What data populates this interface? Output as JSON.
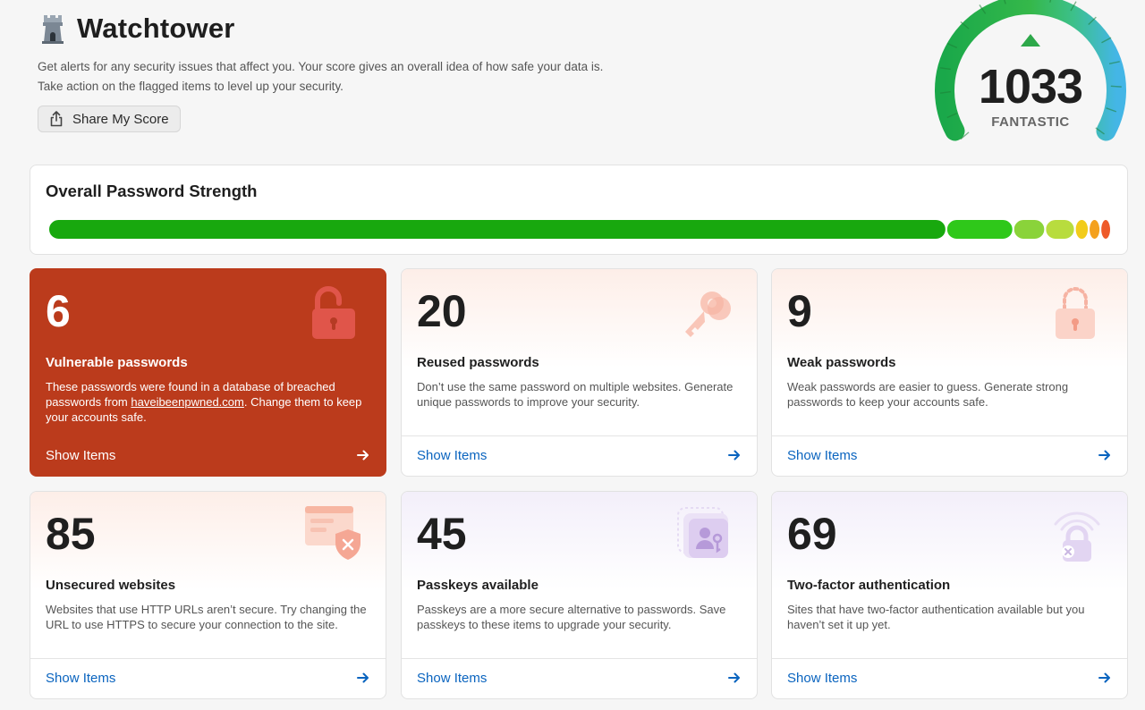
{
  "header": {
    "title": "Watchtower",
    "description": "Get alerts for any security issues that affect you. Your score gives an overall idea of how safe your data is. Take action on the flagged items to level up your security.",
    "share_label": "Share My Score"
  },
  "gauge": {
    "score": "1033",
    "rating": "FANTASTIC"
  },
  "strength": {
    "title": "Overall Password Strength",
    "segments": [
      {
        "fraction": 0.845,
        "color": "#18a80e"
      },
      {
        "fraction": 0.063,
        "color": "#2fc81a"
      },
      {
        "fraction": 0.03,
        "color": "#8ad33a"
      },
      {
        "fraction": 0.028,
        "color": "#b8dc3e"
      },
      {
        "fraction": 0.013,
        "color": "#f2cc1a"
      },
      {
        "fraction": 0.011,
        "color": "#f4a11e"
      },
      {
        "fraction": 0.01,
        "color": "#ee5a2a"
      }
    ]
  },
  "cards": [
    {
      "count": "6",
      "title": "Vulnerable passwords",
      "desc_before": "These passwords were found in a database of breached passwords from ",
      "desc_link": "haveibeenpwned.com",
      "desc_after": ". Change them to keep your accounts safe.",
      "action": "Show Items",
      "icon": "unlocked-padlock-icon"
    },
    {
      "count": "20",
      "title": "Reused passwords",
      "desc": "Don’t use the same password on multiple websites. Generate unique passwords to improve your security.",
      "action": "Show Items",
      "icon": "keys-icon"
    },
    {
      "count": "9",
      "title": "Weak passwords",
      "desc": "Weak passwords are easier to guess. Generate strong passwords to keep your accounts safe.",
      "action": "Show Items",
      "icon": "weak-padlock-icon"
    },
    {
      "count": "85",
      "title": "Unsecured websites",
      "desc": "Websites that use HTTP URLs aren’t secure. Try changing the URL to use HTTPS to secure your connection to the site.",
      "action": "Show Items",
      "icon": "browser-shield-icon"
    },
    {
      "count": "45",
      "title": "Passkeys available",
      "desc": "Passkeys are a more secure alternative to passwords. Save passkeys to these items to upgrade your security.",
      "action": "Show Items",
      "icon": "passkey-icon"
    },
    {
      "count": "69",
      "title": "Two-factor authentication",
      "desc": "Sites that have two-factor authentication available but you haven’t set it up yet.",
      "action": "Show Items",
      "icon": "two-factor-lock-icon"
    }
  ]
}
